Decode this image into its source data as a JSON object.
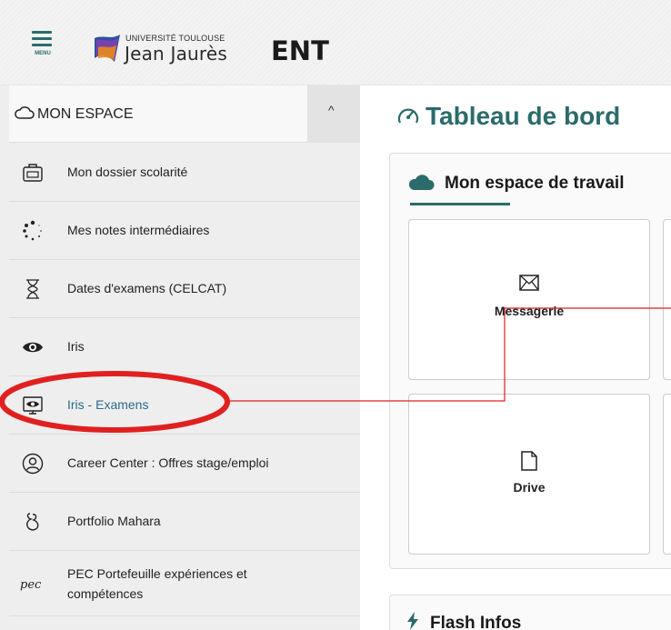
{
  "header": {
    "menu_label": "MENU",
    "logo_top": "UNIVERSITÉ TOULOUSE",
    "logo_name": "Jean Jaurès",
    "app_name": "ENT"
  },
  "sidebar": {
    "section_title": "MON ESPACE",
    "collapse_glyph": "^",
    "items": [
      {
        "label": "Mon dossier scolarité",
        "icon": "briefcase-icon"
      },
      {
        "label": "Mes notes intermédiaires",
        "icon": "spinner-icon"
      },
      {
        "label": "Dates d'examens (CELCAT)",
        "icon": "hourglass-icon"
      },
      {
        "label": "Iris",
        "icon": "eye-icon"
      },
      {
        "label": "Iris - Examens",
        "icon": "eye-screen-icon",
        "active": true
      },
      {
        "label": "Career Center : Offres stage/emploi",
        "icon": "user-circle-icon"
      },
      {
        "label": "Portfolio Mahara",
        "icon": "mahara-icon"
      },
      {
        "label": "PEC Portefeuille expériences et compétences",
        "icon": "pec-icon",
        "icon_text": "pec"
      }
    ]
  },
  "main": {
    "title": "Tableau de bord",
    "workspace": {
      "title": "Mon espace de travail",
      "tiles": [
        {
          "label": "Messagerie",
          "icon": "envelope-icon"
        },
        {
          "label": "Drive",
          "icon": "file-icon"
        }
      ]
    },
    "flash": {
      "title": "Flash Infos"
    }
  },
  "colors": {
    "accent": "#2b6b6b",
    "highlight_circle": "#e02020",
    "annotation_line": "#d82020"
  }
}
